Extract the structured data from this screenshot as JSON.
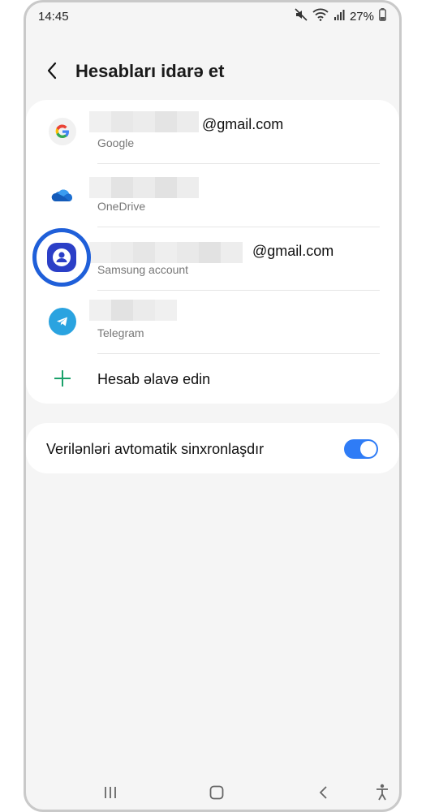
{
  "status_bar": {
    "time": "14:45",
    "battery": "27%",
    "icons": [
      "mute-icon",
      "wifi-icon",
      "signal-icon",
      "battery-icon"
    ]
  },
  "header": {
    "back_icon": "chevron-left-icon",
    "title": "Hesabları idarə et"
  },
  "accounts": [
    {
      "name": "@gmail.com",
      "type": "Google",
      "icon": "google-icon",
      "redacted": true
    },
    {
      "name": "",
      "type": "OneDrive",
      "icon": "onedrive-icon",
      "redacted": true
    },
    {
      "name": "@gmail.com",
      "type": "Samsung account",
      "icon": "samsung-account-icon",
      "redacted": true,
      "highlighted": true
    },
    {
      "name": "",
      "type": "Telegram",
      "icon": "telegram-icon",
      "redacted": true
    }
  ],
  "add_account": {
    "icon": "plus-icon",
    "label": "Hesab əlavə edin"
  },
  "sync": {
    "label": "Verilənləri avtomatik sinxronlaşdır",
    "enabled": true
  },
  "nav_bar": {
    "icons": [
      "recents-icon",
      "home-icon",
      "back-icon",
      "accessibility-icon"
    ]
  },
  "colors": {
    "accent": "#2f7cf6",
    "highlight_ring": "#1f5fd9",
    "add_plus": "#1aa16a",
    "background": "#f5f5f5"
  }
}
